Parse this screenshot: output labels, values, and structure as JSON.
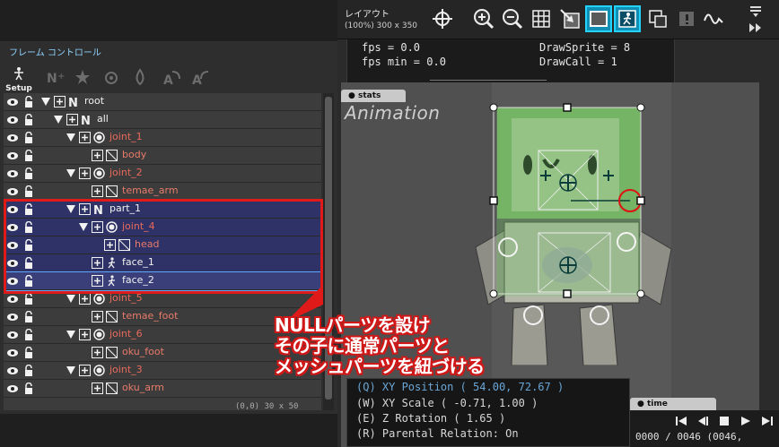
{
  "layout": {
    "title": "レイアウト",
    "subtitle": "(100%) 300 x 350",
    "tools": [
      "crosshair-icon",
      "zoom-in-icon",
      "zoom-out-icon",
      "grid-icon",
      "image-select-icon",
      "frame-icon",
      "figure-icon",
      "layer-icon",
      "info-icon",
      "curve-icon"
    ],
    "selected_tools": [
      "frame-icon",
      "figure-icon"
    ],
    "accent": "#22d3ff"
  },
  "stats": {
    "fps": "fps = 0.0",
    "fps_min": "fps min = 0.0",
    "draw_sprite": "DrawSprite = 8",
    "draw_call": "DrawCall = 1",
    "tab_label": "stats"
  },
  "canvas": {
    "animation_label": "Animation"
  },
  "console": {
    "lines": [
      "(Q) XY Position ( 54.00, 72.67 )",
      "(W) XY Scale ( -0.71, 1.00 )",
      "(E) Z Rotation ( 1.65 )",
      "(R) Parental Relation: On"
    ]
  },
  "time": {
    "tab_label": "time",
    "readout": "0000 / 0046 (0046,"
  },
  "frame_control": {
    "title": "フレーム コントロール",
    "setup_label": "Setup",
    "bottom_readout": "(0,0)  30 x 50",
    "rows": [
      {
        "name": "root",
        "type": "null",
        "indent": 0,
        "expanded": true
      },
      {
        "name": "all",
        "type": "null",
        "indent": 1,
        "expanded": true
      },
      {
        "name": "joint_1",
        "type": "joint",
        "indent": 2,
        "expanded": true
      },
      {
        "name": "body",
        "type": "part",
        "indent": 3
      },
      {
        "name": "joint_2",
        "type": "joint",
        "indent": 2,
        "expanded": true
      },
      {
        "name": "temae_arm",
        "type": "part",
        "indent": 3
      },
      {
        "name": "part_1",
        "type": "null",
        "indent": 2,
        "expanded": true,
        "selected": true
      },
      {
        "name": "joint_4",
        "type": "joint",
        "indent": 3,
        "expanded": true,
        "selected": true
      },
      {
        "name": "head",
        "type": "part",
        "indent": 4,
        "selected": true
      },
      {
        "name": "face_1",
        "type": "figure",
        "indent": 3,
        "selected": true
      },
      {
        "name": "face_2",
        "type": "figure",
        "indent": 3,
        "selected": true,
        "focused": true
      },
      {
        "name": "joint_5",
        "type": "joint",
        "indent": 2,
        "expanded": true
      },
      {
        "name": "temae_foot",
        "type": "part",
        "indent": 3
      },
      {
        "name": "joint_6",
        "type": "joint",
        "indent": 2,
        "expanded": true
      },
      {
        "name": "oku_foot",
        "type": "part",
        "indent": 3
      },
      {
        "name": "joint_3",
        "type": "joint",
        "indent": 2,
        "expanded": true
      },
      {
        "name": "oku_arm",
        "type": "part",
        "indent": 3
      }
    ]
  },
  "annotation": {
    "line1": "NULLパーツを設け",
    "line2": "その子に通常パーツと",
    "line3": "メッシュパーツを紐づける",
    "color": "#e01919"
  }
}
